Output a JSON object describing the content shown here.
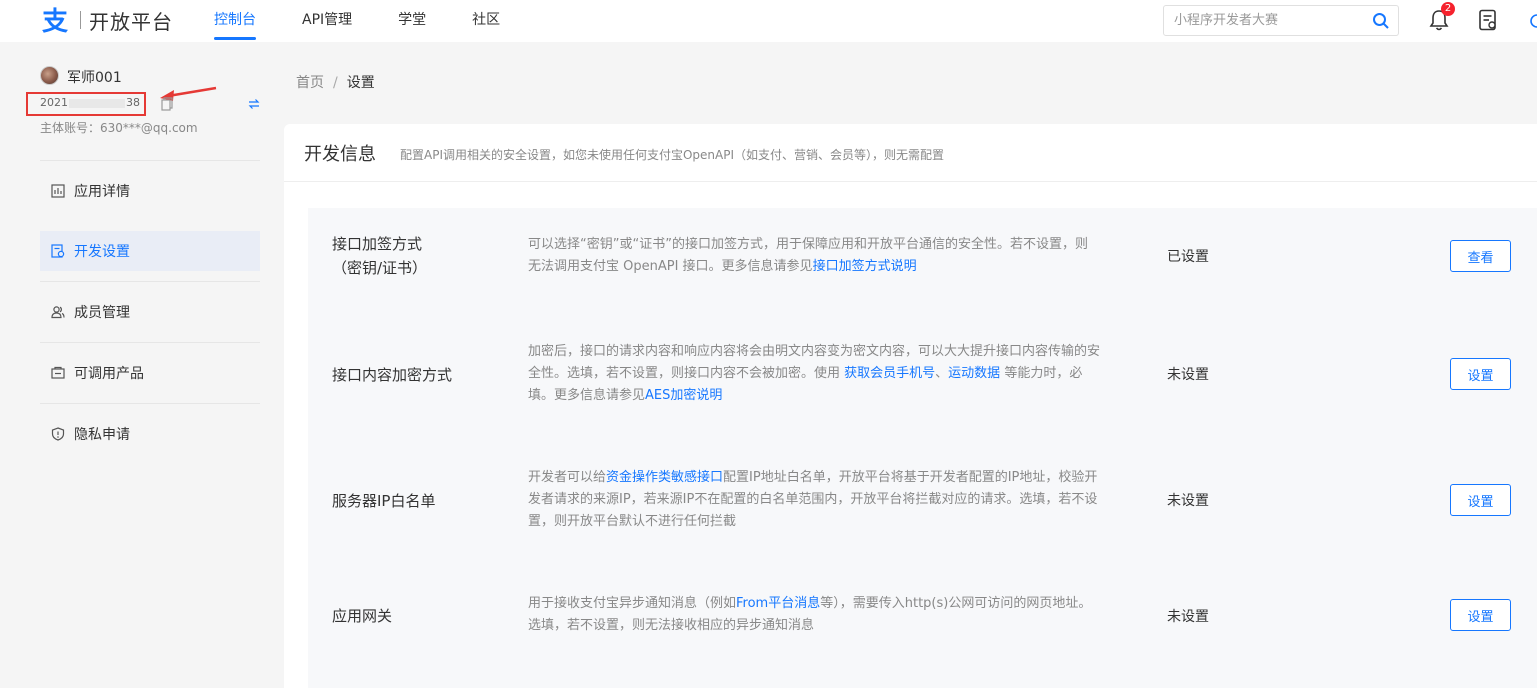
{
  "topbar": {
    "logo_text": "开放平台",
    "nav": [
      "控制台",
      "API管理",
      "学堂",
      "社区"
    ],
    "search_placeholder": "小程序开发者大赛",
    "notification_count": "2"
  },
  "sidebar": {
    "user_name": "军师001",
    "app_id_prefix": "2021",
    "app_id_suffix": "38",
    "owner_account": "主体账号：630***@qq.com",
    "menu": [
      "应用详情",
      "开发设置",
      "成员管理",
      "可调用产品",
      "隐私申请"
    ]
  },
  "breadcrumb": {
    "home": "首页",
    "separator": "/",
    "current": "设置"
  },
  "panel": {
    "title": "开发信息",
    "description": "配置API调用相关的安全设置，如您未使用任何支付宝OpenAPI（如支付、营销、会员等），则无需配置"
  },
  "rows": [
    {
      "name_line1": "接口加签方式",
      "name_line2": "（密钥/证书）",
      "desc_a": "可以选择“密钥”或“证书”的接口加签方式，用于保障应用和开放平台通信的安全性。若不设置，则无法调用支付宝 OpenAPI 接口。更多信息请参见",
      "link_a": "接口加签方式说明",
      "status": "已设置",
      "button": "查看"
    },
    {
      "name_line1": "接口内容加密方式",
      "desc_a": "加密后，接口的请求内容和响应内容将会由明文内容变为密文内容，可以大大提升接口内容传输的安全性。选填，若不设置，则接口内容不会被加密。使用 ",
      "link_a": "获取会员手机号",
      "desc_b": "、",
      "link_b": "运动数据",
      "desc_c": " 等能力时，必填。更多信息请参见",
      "link_c": "AES加密说明",
      "status": "未设置",
      "button": "设置"
    },
    {
      "name_line1": "服务器IP白名单",
      "desc_a": "开发者可以给",
      "link_a": "资金操作类敏感接口",
      "desc_b": "配置IP地址白名单，开放平台将基于开发者配置的IP地址，校验开发者请求的来源IP，若来源IP不在配置的白名单范围内，开放平台将拦截对应的请求。选填，若不设置，则开放平台默认不进行任何拦截",
      "status": "未设置",
      "button": "设置"
    },
    {
      "name_line1": "应用网关",
      "desc_a": "用于接收支付宝异步通知消息（例如",
      "link_a": "From平台消息",
      "desc_b": "等），需要传入http(s)公网可访问的网页地址。选填，若不设置，则无法接收相应的异步通知消息",
      "status": "未设置",
      "button": "设置"
    }
  ]
}
